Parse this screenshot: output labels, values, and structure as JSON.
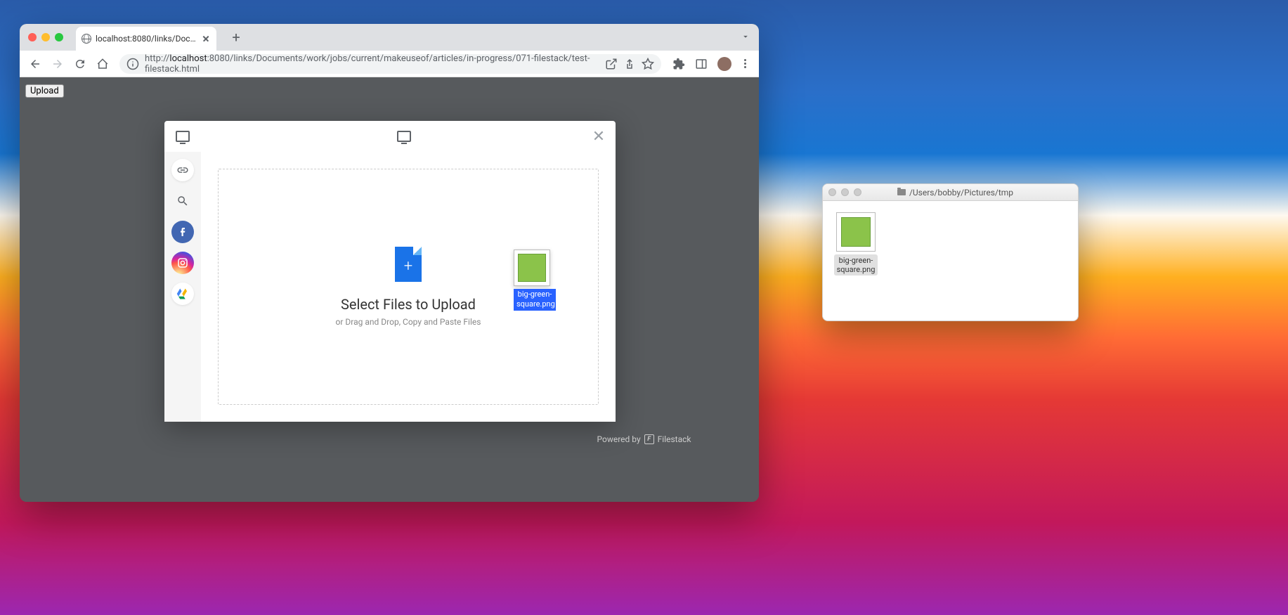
{
  "chrome": {
    "tab_title": "localhost:8080/links/Documen",
    "url_prefix": "http://",
    "url_host": "localhost",
    "url_path": ":8080/links/Documents/work/jobs/current/makeuseof/articles/in-progress/071-filestack/test-filestack.html",
    "upload_button": "Upload"
  },
  "filestack": {
    "dz_title": "Select Files to Upload",
    "dz_subtitle": "or Drag and Drop, Copy and Paste Files",
    "dragged_file_name": "big-green-square.png",
    "powered_by": "Powered by",
    "brand": "Filestack"
  },
  "finder": {
    "path": "/Users/bobby/Pictures/tmp",
    "file_name": "big-green-square.png"
  }
}
